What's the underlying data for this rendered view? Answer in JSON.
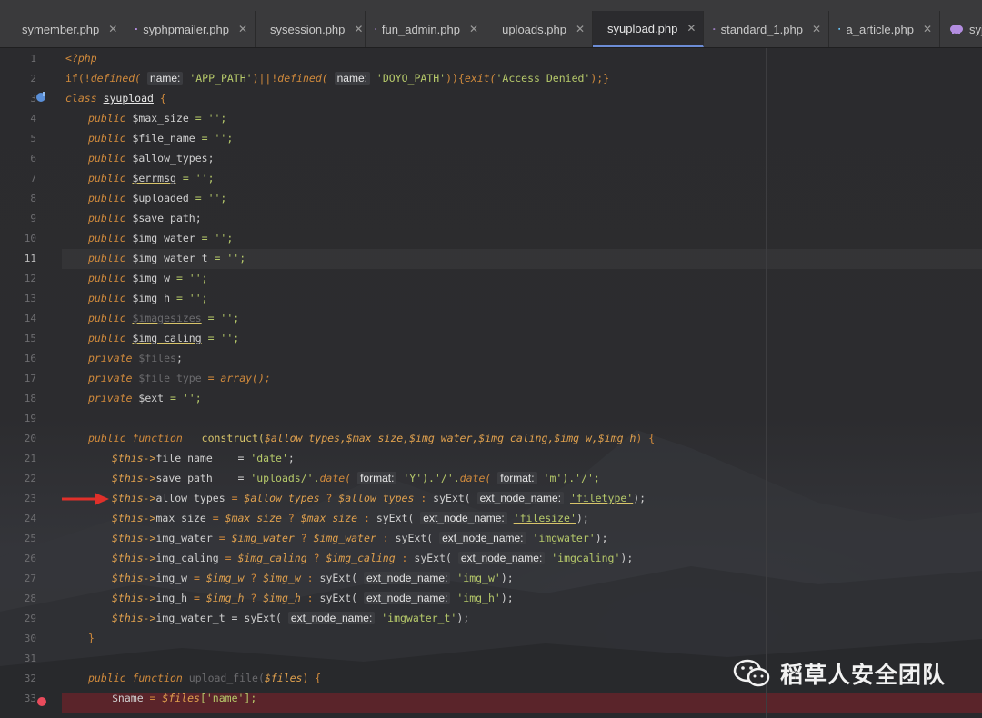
{
  "tabs": [
    {
      "label": "symember.php",
      "icon": "cube-icon",
      "active": false
    },
    {
      "label": "syphpmailer.php",
      "icon": "php-elephant-icon",
      "active": false
    },
    {
      "label": "sysession.php",
      "icon": "cube-icon",
      "active": false
    },
    {
      "label": "fun_admin.php",
      "icon": "php-elephant-icon",
      "active": false
    },
    {
      "label": "uploads.php",
      "icon": "cube-icon",
      "active": false
    },
    {
      "label": "syupload.php",
      "icon": "cube-icon",
      "active": true
    },
    {
      "label": "standard_1.php",
      "icon": "php-elephant-icon",
      "active": false
    },
    {
      "label": "a_article.php",
      "icon": "cube-icon",
      "active": false
    },
    {
      "label": "syjsc",
      "icon": "php-elephant-icon",
      "active": false
    }
  ],
  "close_glyph": "✕",
  "line_numbers": [
    "1",
    "2",
    "3",
    "4",
    "5",
    "6",
    "7",
    "8",
    "9",
    "10",
    "11",
    "12",
    "13",
    "14",
    "15",
    "16",
    "17",
    "18",
    "19",
    "20",
    "21",
    "22",
    "23",
    "24",
    "25",
    "26",
    "27",
    "28",
    "29",
    "30",
    "31",
    "32",
    "33"
  ],
  "current_line": "11",
  "code": {
    "l1": "<?php",
    "l2": {
      "a": "if(!",
      "b": "defined(",
      "c": "name:",
      "d": "'APP_PATH'",
      "e": ")||!",
      "f": "defined(",
      "g": "name:",
      "h": "'DOYO_PATH'",
      "i": ")){",
      "j": "exit(",
      "k": "'Access Denied'",
      "l": ");}"
    },
    "l3": {
      "kw": "class",
      "name": "syupload",
      "brace": "{"
    },
    "props": [
      {
        "mod": "public",
        "name": "$max_size",
        "rest": " = '';"
      },
      {
        "mod": "public",
        "name": "$file_name",
        "rest": " = '';"
      },
      {
        "mod": "public",
        "name": "$allow_types",
        "rest": ";"
      },
      {
        "mod": "public",
        "name": "$errmsg",
        "rest": " = '';"
      },
      {
        "mod": "public",
        "name": "$uploaded",
        "rest": " = '';"
      },
      {
        "mod": "public",
        "name": "$save_path",
        "rest": ";"
      },
      {
        "mod": "public",
        "name": "$img_water",
        "rest": " = '';"
      },
      {
        "mod": "public",
        "name": "$img_water_t",
        "rest": " = '';"
      },
      {
        "mod": "public",
        "name": "$img_w",
        "rest": " = '';"
      },
      {
        "mod": "public",
        "name": "$img_h",
        "rest": " = '';"
      },
      {
        "mod": "public",
        "name": "$imagesizes",
        "rest": " = '';"
      },
      {
        "mod": "public",
        "name": "$img_caling",
        "rest": " = '';"
      },
      {
        "mod": "private",
        "name": "$files",
        "rest": ";"
      },
      {
        "mod": "private",
        "name": "$file_type",
        "rest": " = array();"
      },
      {
        "mod": "private",
        "name": "$ext",
        "rest": " = '';"
      }
    ],
    "l20": {
      "a": "public function",
      "b": "__construct(",
      "c": "$allow_types,$max_size,$img_water,$img_caling,$img_w,$img_h",
      "d": ") {"
    },
    "l21": {
      "a": "$this->",
      "b": "file_name    = ",
      "c": "'date'",
      "d": ";"
    },
    "l22": {
      "a": "$this->",
      "b": "save_path    = ",
      "c": "'uploads/'.",
      "d": "date(",
      "e": "format:",
      "f": "'Y'",
      "g": ").'/'.",
      "h": "date(",
      "i": "format:",
      "j": "'m'",
      "k": ").'/';"
    },
    "syext_lines": [
      {
        "prop": "allow_types",
        "var": "$allow_types",
        "param": "ext_node_name:",
        "str": "'filetype'"
      },
      {
        "prop": "max_size",
        "var": "$max_size",
        "param": "ext_node_name:",
        "str": "'filesize'"
      },
      {
        "prop": "img_water",
        "var": "$img_water",
        "param": "ext_node_name:",
        "str": "'imgwater'"
      },
      {
        "prop": "img_caling",
        "var": "$img_caling",
        "param": "ext_node_name:",
        "str": "'imgcaling'"
      },
      {
        "prop": "img_w",
        "var": "$img_w",
        "param": "ext_node_name:",
        "str": "'img_w'"
      },
      {
        "prop": "img_h",
        "var": "$img_h",
        "param": "ext_node_name:",
        "str": "'img_h'"
      }
    ],
    "l29": {
      "a": "$this->",
      "b": "img_water_t = ",
      "c": "syExt(",
      "d": "ext_node_name:",
      "e": "'imgwater_t'",
      "f": ");"
    },
    "l30": "}",
    "l32": {
      "a": "public function",
      "b": "upload_file(",
      "c": "$files",
      "d": ") {"
    },
    "l33": {
      "a": "$name",
      "b": " = ",
      "c": "$files",
      "d": "['name'];"
    }
  },
  "watermark": {
    "text": "稻草人安全团队",
    "icon": "wechat-icon"
  },
  "colors": {
    "accent": "#6c8cd5",
    "keyword": "#d08a3c",
    "string": "#b6c96a",
    "breakpoint": "#e94b5c",
    "arrow": "#e0302a"
  }
}
